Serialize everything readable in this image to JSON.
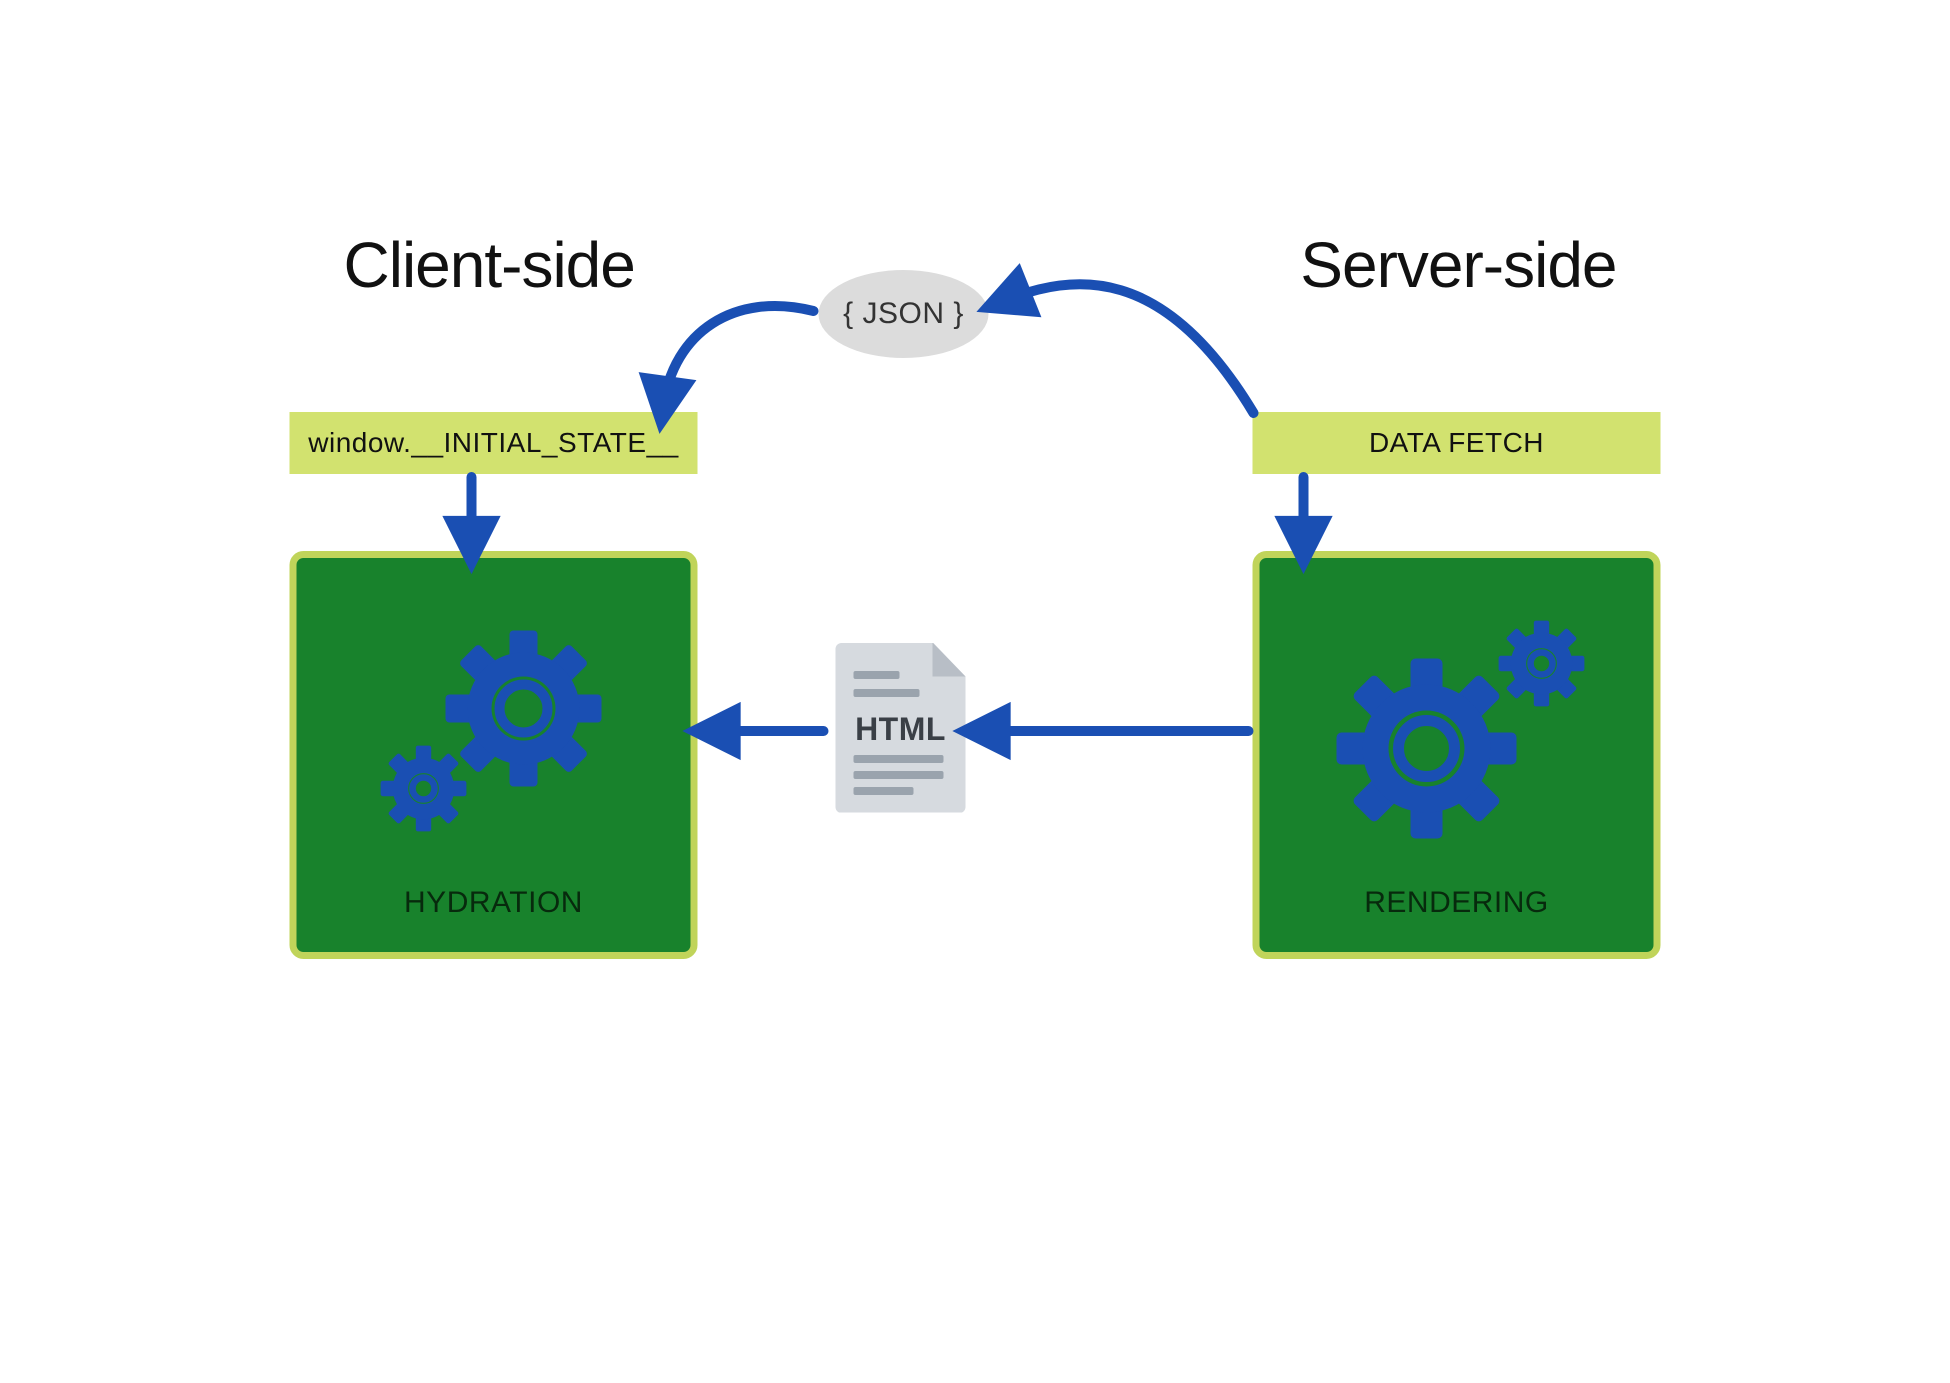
{
  "headings": {
    "client": "Client-side",
    "server": "Server-side"
  },
  "labels": {
    "initial_state": "window.__INITIAL_STATE__",
    "data_fetch": "DATA FETCH"
  },
  "nodes": {
    "json": "{ JSON }",
    "html": "HTML"
  },
  "boxes": {
    "hydration": "HYDRATION",
    "rendering": "RENDERING"
  },
  "colors": {
    "arrow": "#1a4fb3",
    "gear": "#1a4fb3",
    "box_fill": "#18822c",
    "box_border": "#c0d45a",
    "label_bg": "#d2e26f",
    "json_bg": "#dcdcdc",
    "paper": "#d6dadf"
  },
  "icons": {
    "gears_hydration": "gears-icon",
    "gears_rendering": "gears-icon",
    "html_file": "html-document-icon"
  },
  "flow": [
    {
      "from": "DATA FETCH",
      "to": "{ JSON }"
    },
    {
      "from": "{ JSON }",
      "to": "window.__INITIAL_STATE__"
    },
    {
      "from": "window.__INITIAL_STATE__",
      "to": "HYDRATION"
    },
    {
      "from": "DATA FETCH",
      "to": "RENDERING"
    },
    {
      "from": "RENDERING",
      "to": "HTML"
    },
    {
      "from": "HTML",
      "to": "HYDRATION"
    }
  ]
}
